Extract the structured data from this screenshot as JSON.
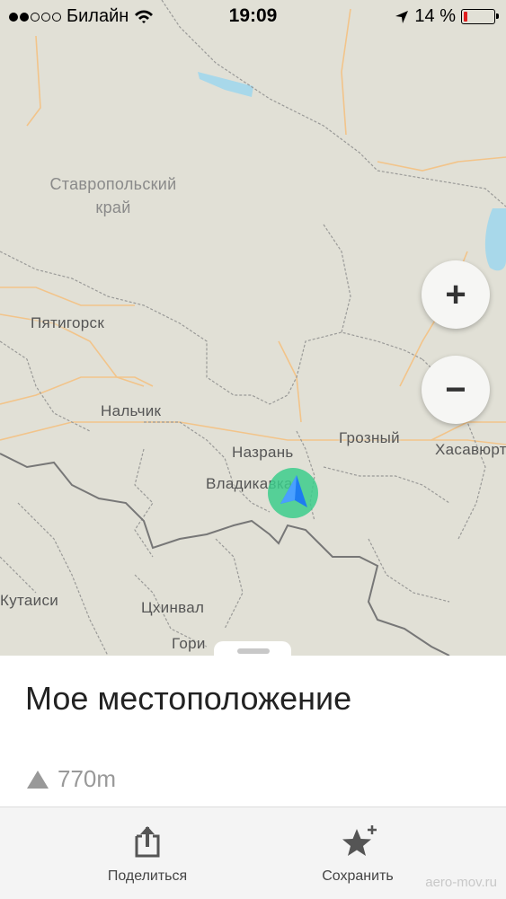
{
  "status_bar": {
    "carrier": "Билайн",
    "time": "19:09",
    "battery_percent": "14 %",
    "signal_bars_filled": 2,
    "signal_bars_total": 5,
    "battery_level": 0.14
  },
  "map": {
    "region_label": "Ставропольский\nкрай",
    "cities": {
      "pyatigorsk": "Пятигорск",
      "nalchik": "Нальчик",
      "nazran": "Назрань",
      "grozny": "Грозный",
      "khasavyurt": "Хасавюрт",
      "vladikavkaz": "Владикавказ",
      "kutaisi": "Кутаиси",
      "tskhinval": "Цхинвал",
      "gori": "Гори"
    },
    "zoom_in": "+",
    "zoom_out": "−",
    "colors": {
      "land": "#e1e0d6",
      "water": "#a8d8ea",
      "road": "#f2c48a",
      "border": "#777777",
      "location": "#3ccd8c",
      "arrow": "#1e7cf0"
    }
  },
  "sheet": {
    "title": "Мое местоположение",
    "elevation": "770m"
  },
  "toolbar": {
    "share_label": "Поделиться",
    "save_label": "Сохранить"
  },
  "watermark": "aero-mov.ru",
  "icons": [
    "wifi-icon",
    "location-arrow-icon",
    "share-icon",
    "star-add-icon",
    "elevation-triangle-icon"
  ]
}
